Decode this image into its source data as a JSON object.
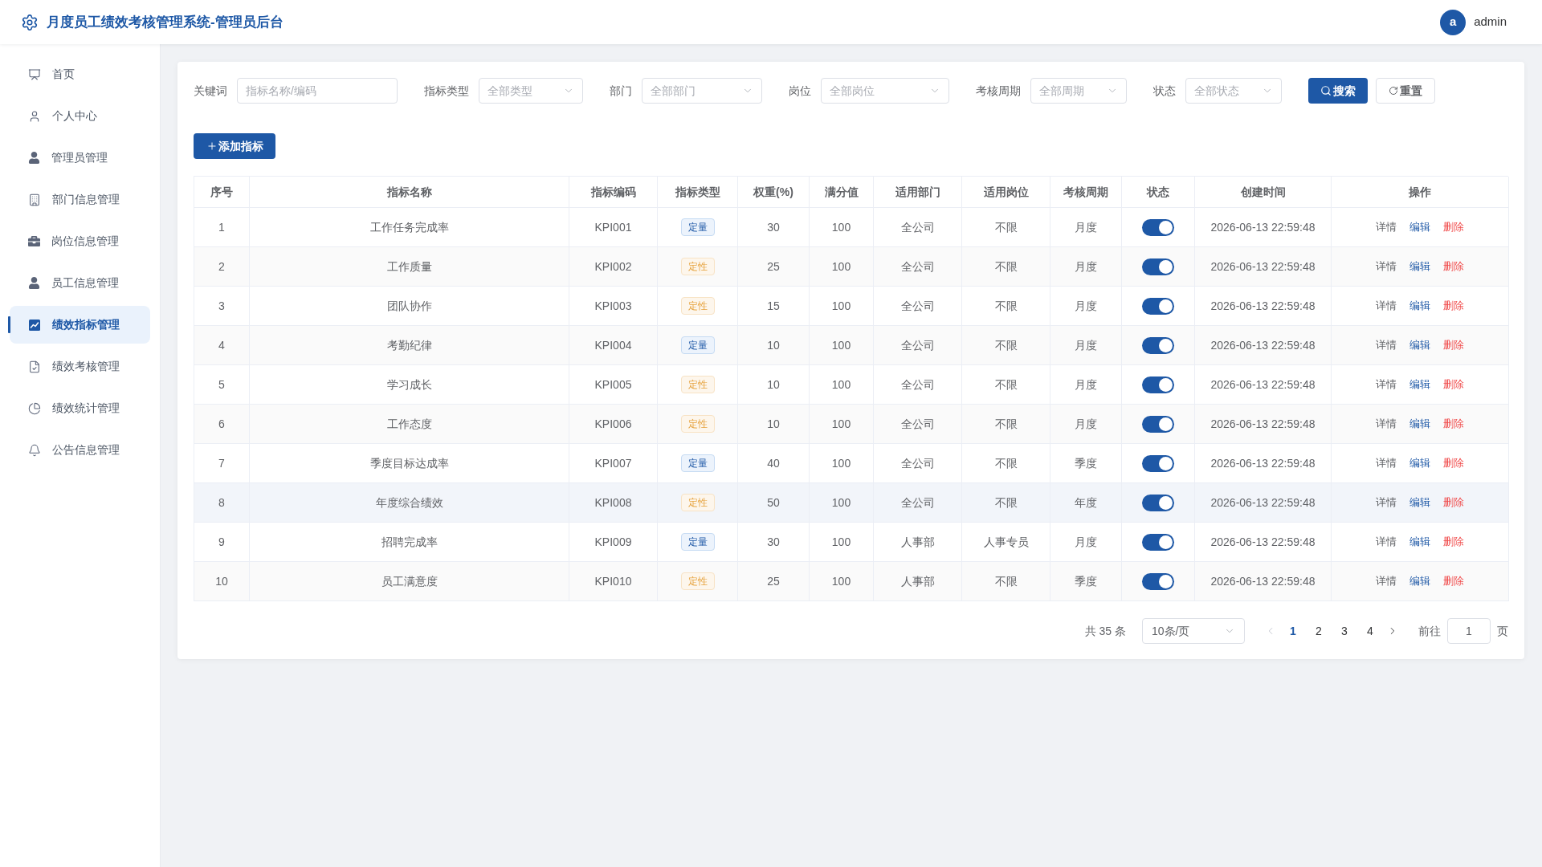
{
  "header": {
    "title": "月度员工绩效考核管理系统-管理员后台",
    "user": {
      "avatar_letter": "a",
      "name": "admin"
    }
  },
  "sidebar": {
    "items": [
      {
        "label": "首页",
        "selected": false
      },
      {
        "label": "个人中心",
        "selected": false
      },
      {
        "label": "管理员管理",
        "selected": false
      },
      {
        "label": "部门信息管理",
        "selected": false
      },
      {
        "label": "岗位信息管理",
        "selected": false
      },
      {
        "label": "员工信息管理",
        "selected": false
      },
      {
        "label": "绩效指标管理",
        "selected": true
      },
      {
        "label": "绩效考核管理",
        "selected": false
      },
      {
        "label": "绩效统计管理",
        "selected": false
      },
      {
        "label": "公告信息管理",
        "selected": false
      }
    ]
  },
  "filters": [
    {
      "label": "关键词",
      "kind": "input",
      "placeholder": "指标名称/编码"
    },
    {
      "label": "指标类型",
      "kind": "select",
      "placeholder": "全部类型"
    },
    {
      "label": "部门",
      "kind": "select",
      "placeholder": "全部部门"
    },
    {
      "label": "岗位",
      "kind": "select",
      "placeholder": "全部岗位"
    },
    {
      "label": "考核周期",
      "kind": "select",
      "placeholder": "全部周期"
    },
    {
      "label": "状态",
      "kind": "select",
      "placeholder": "全部状态"
    }
  ],
  "filter_buttons": [
    {
      "label": "搜索",
      "kind": "search"
    },
    {
      "label": "重置",
      "kind": "reset"
    }
  ],
  "add_button": {
    "label": "添加指标"
  },
  "table": {
    "columns": [
      "序号",
      "指标名称",
      "指标编码",
      "指标类型",
      "权重(%)",
      "满分值",
      "适用部门",
      "适用岗位",
      "考核周期",
      "状态",
      "创建时间",
      "操作"
    ],
    "rows": [
      {
        "hovered": false,
        "index": "1",
        "name": "工作任务完成率",
        "code": "KPI001",
        "type": {
          "label": "定量",
          "kind": "quantitative"
        },
        "weight": "30",
        "full_score": "100",
        "department": "全公司",
        "position": "不限",
        "cycle": "月度",
        "enabled": true,
        "created_at": "2026-06-13 22:59:48",
        "actions": [
          {
            "label": "详情",
            "kind": "view"
          },
          {
            "label": "编辑",
            "kind": "edit"
          },
          {
            "label": "删除",
            "kind": "delete"
          }
        ]
      },
      {
        "hovered": false,
        "index": "2",
        "name": "工作质量",
        "code": "KPI002",
        "type": {
          "label": "定性",
          "kind": "qualitative"
        },
        "weight": "25",
        "full_score": "100",
        "department": "全公司",
        "position": "不限",
        "cycle": "月度",
        "enabled": true,
        "created_at": "2026-06-13 22:59:48",
        "actions": [
          {
            "label": "详情",
            "kind": "view"
          },
          {
            "label": "编辑",
            "kind": "edit"
          },
          {
            "label": "删除",
            "kind": "delete"
          }
        ]
      },
      {
        "hovered": false,
        "index": "3",
        "name": "团队协作",
        "code": "KPI003",
        "type": {
          "label": "定性",
          "kind": "qualitative"
        },
        "weight": "15",
        "full_score": "100",
        "department": "全公司",
        "position": "不限",
        "cycle": "月度",
        "enabled": true,
        "created_at": "2026-06-13 22:59:48",
        "actions": [
          {
            "label": "详情",
            "kind": "view"
          },
          {
            "label": "编辑",
            "kind": "edit"
          },
          {
            "label": "删除",
            "kind": "delete"
          }
        ]
      },
      {
        "hovered": false,
        "index": "4",
        "name": "考勤纪律",
        "code": "KPI004",
        "type": {
          "label": "定量",
          "kind": "quantitative"
        },
        "weight": "10",
        "full_score": "100",
        "department": "全公司",
        "position": "不限",
        "cycle": "月度",
        "enabled": true,
        "created_at": "2026-06-13 22:59:48",
        "actions": [
          {
            "label": "详情",
            "kind": "view"
          },
          {
            "label": "编辑",
            "kind": "edit"
          },
          {
            "label": "删除",
            "kind": "delete"
          }
        ]
      },
      {
        "hovered": false,
        "index": "5",
        "name": "学习成长",
        "code": "KPI005",
        "type": {
          "label": "定性",
          "kind": "qualitative"
        },
        "weight": "10",
        "full_score": "100",
        "department": "全公司",
        "position": "不限",
        "cycle": "月度",
        "enabled": true,
        "created_at": "2026-06-13 22:59:48",
        "actions": [
          {
            "label": "详情",
            "kind": "view"
          },
          {
            "label": "编辑",
            "kind": "edit"
          },
          {
            "label": "删除",
            "kind": "delete"
          }
        ]
      },
      {
        "hovered": false,
        "index": "6",
        "name": "工作态度",
        "code": "KPI006",
        "type": {
          "label": "定性",
          "kind": "qualitative"
        },
        "weight": "10",
        "full_score": "100",
        "department": "全公司",
        "position": "不限",
        "cycle": "月度",
        "enabled": true,
        "created_at": "2026-06-13 22:59:48",
        "actions": [
          {
            "label": "详情",
            "kind": "view"
          },
          {
            "label": "编辑",
            "kind": "edit"
          },
          {
            "label": "删除",
            "kind": "delete"
          }
        ]
      },
      {
        "hovered": false,
        "index": "7",
        "name": "季度目标达成率",
        "code": "KPI007",
        "type": {
          "label": "定量",
          "kind": "quantitative"
        },
        "weight": "40",
        "full_score": "100",
        "department": "全公司",
        "position": "不限",
        "cycle": "季度",
        "enabled": true,
        "created_at": "2026-06-13 22:59:48",
        "actions": [
          {
            "label": "详情",
            "kind": "view"
          },
          {
            "label": "编辑",
            "kind": "edit"
          },
          {
            "label": "删除",
            "kind": "delete"
          }
        ]
      },
      {
        "hovered": true,
        "index": "8",
        "name": "年度综合绩效",
        "code": "KPI008",
        "type": {
          "label": "定性",
          "kind": "qualitative"
        },
        "weight": "50",
        "full_score": "100",
        "department": "全公司",
        "position": "不限",
        "cycle": "年度",
        "enabled": true,
        "created_at": "2026-06-13 22:59:48",
        "actions": [
          {
            "label": "详情",
            "kind": "view"
          },
          {
            "label": "编辑",
            "kind": "edit"
          },
          {
            "label": "删除",
            "kind": "delete"
          }
        ]
      },
      {
        "hovered": false,
        "index": "9",
        "name": "招聘完成率",
        "code": "KPI009",
        "type": {
          "label": "定量",
          "kind": "quantitative"
        },
        "weight": "30",
        "full_score": "100",
        "department": "人事部",
        "position": "人事专员",
        "cycle": "月度",
        "enabled": true,
        "created_at": "2026-06-13 22:59:48",
        "actions": [
          {
            "label": "详情",
            "kind": "view"
          },
          {
            "label": "编辑",
            "kind": "edit"
          },
          {
            "label": "删除",
            "kind": "delete"
          }
        ]
      },
      {
        "hovered": false,
        "index": "10",
        "name": "员工满意度",
        "code": "KPI010",
        "type": {
          "label": "定性",
          "kind": "qualitative"
        },
        "weight": "25",
        "full_score": "100",
        "department": "人事部",
        "position": "不限",
        "cycle": "季度",
        "enabled": true,
        "created_at": "2026-06-13 22:59:48",
        "actions": [
          {
            "label": "详情",
            "kind": "view"
          },
          {
            "label": "编辑",
            "kind": "edit"
          },
          {
            "label": "删除",
            "kind": "delete"
          }
        ]
      }
    ]
  },
  "pagination": {
    "total": "共 35 条",
    "page_size": "10条/页",
    "prev": {
      "disabled": true
    },
    "pages": [
      {
        "label": "1",
        "selected": true
      },
      {
        "label": "2",
        "selected": false
      },
      {
        "label": "3",
        "selected": false
      },
      {
        "label": "4",
        "selected": false
      }
    ],
    "next": {
      "disabled": false
    },
    "goto_label": "前往",
    "goto_value": "1",
    "goto_unit": "页"
  }
}
